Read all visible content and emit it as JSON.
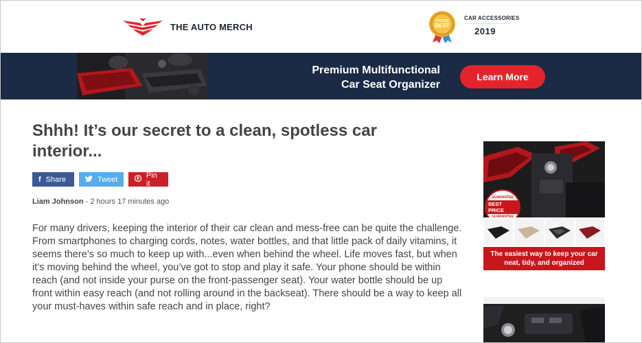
{
  "header": {
    "brand": "THE AUTO MERCH",
    "logo_icon": "winged-chevron-logo",
    "award": {
      "badge_top": "VOTED",
      "badge_main": "BEST",
      "label": "CAR ACCESSORIES",
      "year": "2019"
    }
  },
  "banner": {
    "title_line1": "Premium Multifunctional",
    "title_line2": "Car Seat Organizer",
    "cta": "Learn More"
  },
  "article": {
    "title": "Shhh! It’s our secret to a clean, spotless car interior...",
    "share": [
      {
        "icon": "f",
        "label": "Share",
        "network": "facebook"
      },
      {
        "icon": "🐦",
        "label": "Tweet",
        "network": "twitter"
      },
      {
        "icon": "P",
        "label": "Pin it",
        "network": "pinterest"
      }
    ],
    "author": "Liam Johnson",
    "time": " - 2 hours 17 minutes ago",
    "body": "For many drivers, keeping the interior of their car clean and mess-free can be quite the challenge. From smartphones to charging cords, notes, water bottles, and that little pack of daily vitamins, it seems there’s so much to keep up with...even when behind the wheel. Life moves fast, but when it’s moving behind the wheel, you’ve got to stop and play it safe. Your phone should be within reach (and not inside your purse on the front-passenger seat). Your water bottle should be up front within easy reach (and not rolling around in the backseat). There should be a way to keep all your must-haves within safe reach and in place, right?"
  },
  "sidebar": {
    "ad1": {
      "badge_top": "GUARANTEE",
      "badge_main": "BEST PRICE",
      "badge_bottom": "GUARANTEE",
      "caption": "The easiest way to keep your car neat, tidy, and organized"
    }
  },
  "colors": {
    "brand_red": "#e3252b",
    "banner_navy": "#1b2a45",
    "facebook": "#3b5998",
    "twitter": "#55acee",
    "pinterest": "#cb2027",
    "award_gold": "#e8a92a"
  }
}
